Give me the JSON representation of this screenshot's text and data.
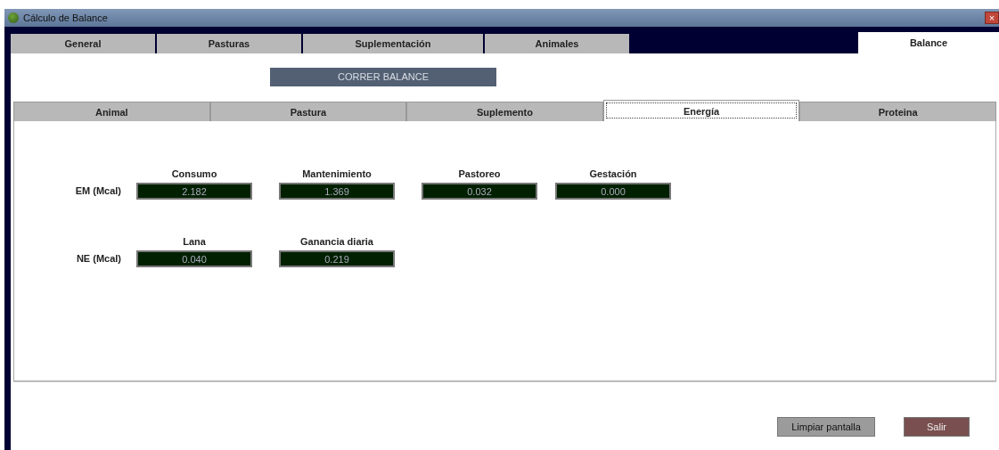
{
  "window": {
    "title": "Cálculo de Balance",
    "close": "×"
  },
  "tabs": [
    {
      "label": "General",
      "selected": false
    },
    {
      "label": "Pasturas",
      "selected": false
    },
    {
      "label": "Suplementación",
      "selected": false
    },
    {
      "label": "Animales",
      "selected": false
    },
    {
      "label": "Balance",
      "selected": true
    }
  ],
  "run_button": "CORRER BALANCE",
  "subtabs": [
    {
      "label": "Animal",
      "selected": false
    },
    {
      "label": "Pastura",
      "selected": false
    },
    {
      "label": "Suplemento",
      "selected": false
    },
    {
      "label": "Energía",
      "selected": true
    },
    {
      "label": "Proteina",
      "selected": false
    }
  ],
  "rows": [
    {
      "label": "EM (Mcal)",
      "fields": [
        {
          "label": "Consumo",
          "value": "2.182"
        },
        {
          "label": "Mantenimiento",
          "value": "1.369"
        },
        {
          "label": "Pastoreo",
          "value": "0.032"
        },
        {
          "label": "Gestación",
          "value": "0.000"
        }
      ]
    },
    {
      "label": "NE (Mcal)",
      "fields": [
        {
          "label": "Lana",
          "value": "0.040"
        },
        {
          "label": "Ganancia diaria",
          "value": "0.219"
        }
      ]
    }
  ],
  "buttons": [
    {
      "label": "Limpiar pantalla",
      "kind": "clear"
    },
    {
      "label": "Salir",
      "kind": "exit"
    }
  ]
}
